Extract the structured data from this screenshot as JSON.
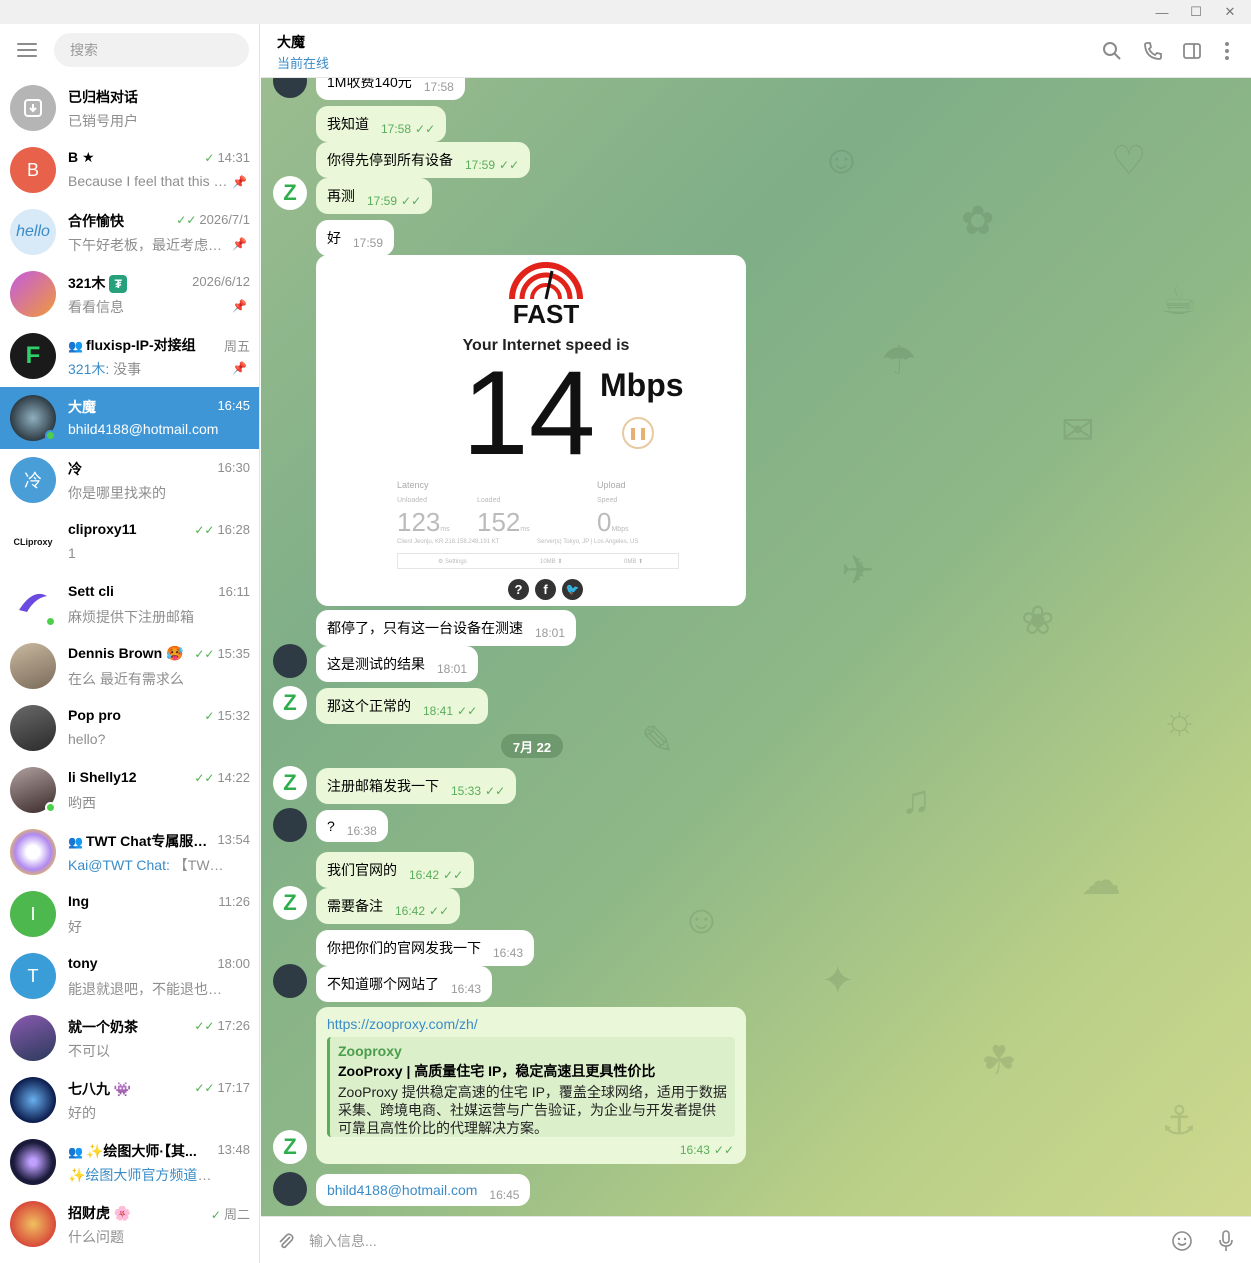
{
  "window": {
    "min": "—",
    "max": "☐",
    "close": "✕"
  },
  "sidebar": {
    "search_placeholder": "搜索",
    "chats": [
      {
        "name": "已归档对话",
        "time": "",
        "msg": "已销号用户",
        "color": "#b5b5b5",
        "initial": ""
      },
      {
        "name": "B ★",
        "time": "14:31",
        "msg": "Because I feel that this is ...",
        "color": "#e8624b",
        "initial": "B"
      },
      {
        "name": "合作愉快",
        "time": "2026/7/1",
        "msg": "下午好老板，最近考虑接...",
        "color": "#cfe3f5",
        "initial": "hello"
      },
      {
        "name": "321木",
        "time": "2026/6/12",
        "msg": "看看信息",
        "color": "#b35ad6",
        "initial": ""
      },
      {
        "name": "fluxisp-IP-对接组",
        "time": "周五",
        "who": "321木:",
        "msg": " 没事",
        "color": "#1a1a1a",
        "initial": "F"
      },
      {
        "name": "大魔",
        "time": "16:45",
        "msg": "bhild4188@hotmail.com",
        "color": "#2e3b44",
        "initial": ""
      },
      {
        "name": "冷",
        "time": "16:30",
        "msg": "你是哪里找来的",
        "color": "#4a9ed8",
        "initial": "冷"
      },
      {
        "name": "cliproxy11",
        "time": "16:28",
        "msg": "1",
        "color": "#ffffff",
        "initial": "CLiproxy"
      },
      {
        "name": "Sett cli",
        "time": "16:11",
        "msg": "麻烦提供下注册邮箱",
        "color": "#ffffff",
        "initial": ""
      },
      {
        "name": "Dennis Brown 🥵",
        "time": "15:35",
        "msg": "在么 最近有需求么",
        "color": "#8a7a6a",
        "initial": ""
      },
      {
        "name": "Pop pro",
        "time": "15:32",
        "msg": "hello?",
        "color": "#4a4a4a",
        "initial": ""
      },
      {
        "name": "li Shelly12",
        "time": "14:22",
        "msg": "哟西",
        "color": "#6a5a5a",
        "initial": ""
      },
      {
        "name": "TWT Chat专属服务...",
        "time": "13:54",
        "who": "Kai@TWT Chat:",
        "msg": " 【TWT Chat ...",
        "color": "#f0e8ff",
        "initial": ""
      },
      {
        "name": "Ing",
        "time": "11:26",
        "msg": "好",
        "color": "#4db84d",
        "initial": "I"
      },
      {
        "name": "tony",
        "time": "18:00",
        "msg": "能退就退吧，不能退也就算了...",
        "color": "#3a9dd8",
        "initial": "T"
      },
      {
        "name": "就一个奶茶",
        "time": "17:26",
        "msg": "不可以",
        "color": "#5a4a6a",
        "initial": ""
      },
      {
        "name": "七八九 👾",
        "time": "17:17",
        "msg": "好的",
        "color": "#1a2a5a",
        "initial": ""
      },
      {
        "name": "✨绘图大师·【其...",
        "time": "13:48",
        "who": "✨绘图大师官方频道✨P图...",
        "msg": "",
        "color": "#1a1a3a",
        "initial": ""
      },
      {
        "name": "招财虎 🌸",
        "time": "周二",
        "msg": "什么问题",
        "color": "#d84a3a",
        "initial": ""
      }
    ]
  },
  "header": {
    "title": "大魔",
    "status": "当前在线"
  },
  "messages": {
    "m0": {
      "text": "1M收费140元",
      "time": "17:58"
    },
    "m1": {
      "text": "我知道",
      "time": "17:58"
    },
    "m2": {
      "text": "你得先停到所有设备",
      "time": "17:59"
    },
    "m3": {
      "text": "再测",
      "time": "17:59"
    },
    "m4": {
      "text": "好",
      "time": "17:59"
    },
    "m5": {
      "text": "都停了，只有这一台设备在测速",
      "time": "18:01"
    },
    "m6": {
      "text": "这是测试的结果",
      "time": "18:01"
    },
    "m7": {
      "text": "那这个正常的",
      "time": "18:41"
    },
    "date": "7月 22",
    "m8": {
      "text": "注册邮箱发我一下",
      "time": "15:33"
    },
    "m9": {
      "text": "?",
      "time": "16:38"
    },
    "m10": {
      "text": "我们官网的",
      "time": "16:42"
    },
    "m11": {
      "text": "需要备注",
      "time": "16:42"
    },
    "m12": {
      "text": "你把你们的官网发我一下",
      "time": "16:43"
    },
    "m13": {
      "text": "不知道哪个网站了",
      "time": "16:43"
    },
    "m14": {
      "text": "bhild4188@hotmail.com",
      "time": "16:45"
    }
  },
  "speedtest": {
    "logo": "FAST",
    "heading": "Your Internet speed is",
    "value": "14",
    "unit": "Mbps",
    "latency_label": "Latency",
    "upload_label": "Upload",
    "unloaded_label": "Unloaded",
    "loaded_label": "Loaded",
    "speed_label": "Speed",
    "unloaded": "123",
    "loaded": "152",
    "upload": "0",
    "ms": "ms",
    "mbps": "Mbps",
    "client": "Client   Jeonju, KR   218.158.248.191   KT",
    "servers": "Server(s)  Tokyo, JP | Los Angeles, US",
    "settings": "⚙ Settings",
    "mb1": "10MB ⬆",
    "mb2": "0MB ⬆"
  },
  "link": {
    "url": "https://zooproxy.com/zh/",
    "site": "Zooproxy",
    "title": "ZooProxy | 高质量住宅 IP，稳定高速且更具性价比",
    "desc": "ZooProxy 提供稳定高速的住宅 IP，覆盖全球网络，适用于数据采集、跨境电商、社媒运营与广告验证，为企业与开发者提供可靠且高性价比的代理解决方案。",
    "time": "16:43"
  },
  "composer": {
    "placeholder": "输入信息..."
  },
  "colors": {
    "accent": "#3f96d6",
    "online": "#4cd04c",
    "check": "#5bad5b"
  }
}
